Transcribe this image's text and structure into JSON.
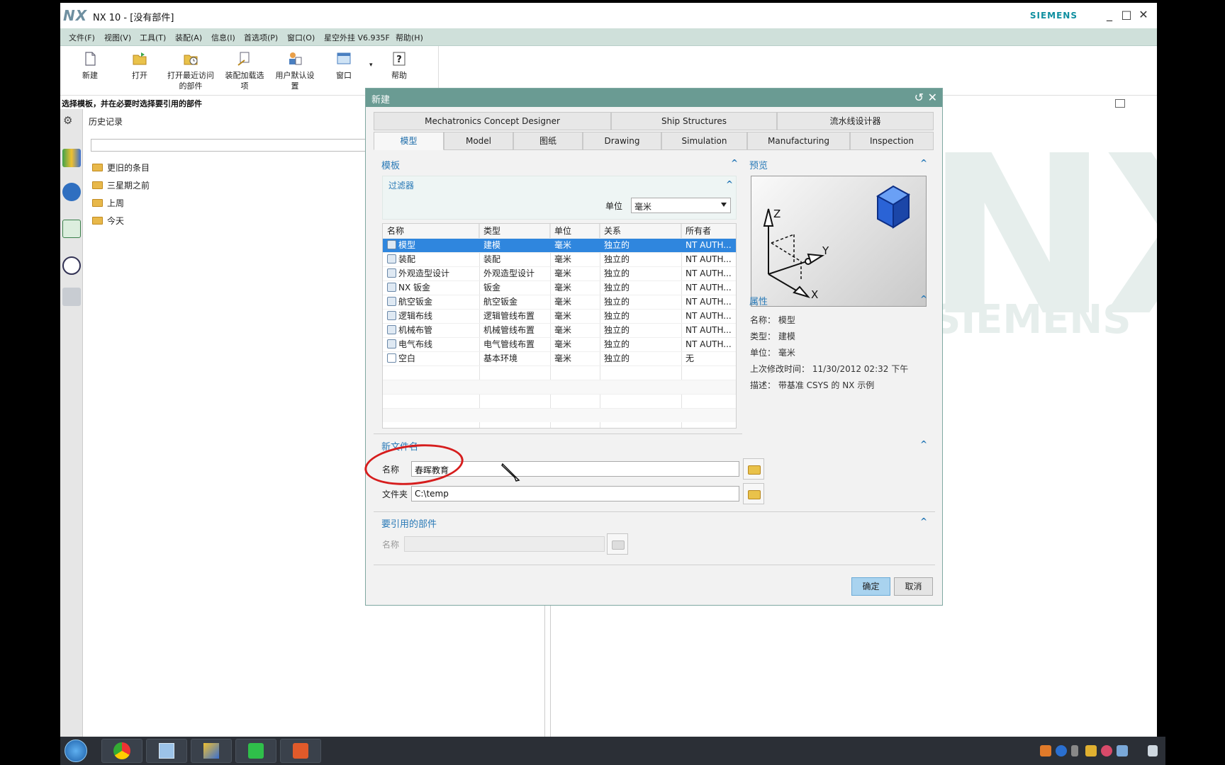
{
  "window": {
    "logo": "NX",
    "title": "NX 10 - [没有部件]",
    "brand": "SIEMENS"
  },
  "menu": [
    "文件(F)",
    "视图(V)",
    "工具(T)",
    "装配(A)",
    "信息(I)",
    "首选项(P)",
    "窗口(O)",
    "星空外挂 V6.935F",
    "帮助(H)"
  ],
  "ribbon": {
    "new": "新建",
    "open": "打开",
    "recent_line1": "打开最近访问",
    "recent_line2": "的部件",
    "asm_line1": "装配加载选",
    "asm_line2": "项",
    "user_line1": "用户默认设",
    "user_line2": "置",
    "window": "窗口",
    "help": "帮助"
  },
  "status": "选择模板，并在必要时选择要引用的部件",
  "history": {
    "title": "历史记录",
    "items": [
      "更旧的条目",
      "三星期之前",
      "上周",
      "今天"
    ]
  },
  "watermark": {
    "nx": "NX",
    "siemens": "SIEMENS"
  },
  "dialog": {
    "title": "新建",
    "tabs_row1": [
      "Mechatronics Concept Designer",
      "Ship Structures",
      "流水线设计器"
    ],
    "tabs_row2": [
      "模型",
      "Model",
      "图纸",
      "Drawing",
      "Simulation",
      "Manufacturing",
      "Inspection"
    ],
    "active_tab": "模型",
    "template_section": "模板",
    "filter_section": "过滤器",
    "unit_label": "单位",
    "unit_value": "毫米",
    "columns": [
      "名称",
      "类型",
      "单位",
      "关系",
      "所有者"
    ],
    "rows": [
      {
        "name": "模型",
        "type": "建模",
        "unit": "毫米",
        "rel": "独立的",
        "owner": "NT AUTH..."
      },
      {
        "name": "装配",
        "type": "装配",
        "unit": "毫米",
        "rel": "独立的",
        "owner": "NT AUTH..."
      },
      {
        "name": "外观造型设计",
        "type": "外观造型设计",
        "unit": "毫米",
        "rel": "独立的",
        "owner": "NT AUTH..."
      },
      {
        "name": "NX 钣金",
        "type": "钣金",
        "unit": "毫米",
        "rel": "独立的",
        "owner": "NT AUTH..."
      },
      {
        "name": "航空钣金",
        "type": "航空钣金",
        "unit": "毫米",
        "rel": "独立的",
        "owner": "NT AUTH..."
      },
      {
        "name": "逻辑布线",
        "type": "逻辑管线布置",
        "unit": "毫米",
        "rel": "独立的",
        "owner": "NT AUTH..."
      },
      {
        "name": "机械布管",
        "type": "机械管线布置",
        "unit": "毫米",
        "rel": "独立的",
        "owner": "NT AUTH..."
      },
      {
        "name": "电气布线",
        "type": "电气管线布置",
        "unit": "毫米",
        "rel": "独立的",
        "owner": "NT AUTH..."
      },
      {
        "name": "空白",
        "type": "基本环境",
        "unit": "毫米",
        "rel": "独立的",
        "owner": "无"
      }
    ],
    "selected_row": "模型",
    "preview_section": "预览",
    "preview_axes": [
      "Z",
      "Y",
      "X"
    ],
    "props_section": "属性",
    "props": [
      "名称： 模型",
      "类型： 建模",
      "单位： 毫米",
      "上次修改时间： 11/30/2012 02:32 下午",
      "描述： 带基准 CSYS 的 NX 示例"
    ],
    "newfile_section": "新文件名",
    "name_label": "名称",
    "name_value": "春晖教育",
    "folder_label": "文件夹",
    "folder_value": "C:\\temp",
    "ref_section": "要引用的部件",
    "ref_name_label": "名称",
    "ok": "确定",
    "cancel": "取消"
  },
  "colors": {
    "menubar": "#cfe0da",
    "dialog_title": "#6a9b93",
    "selection": "#2f86de",
    "section_title": "#2a7ab7",
    "annotation_circle": "#d61d1d"
  }
}
